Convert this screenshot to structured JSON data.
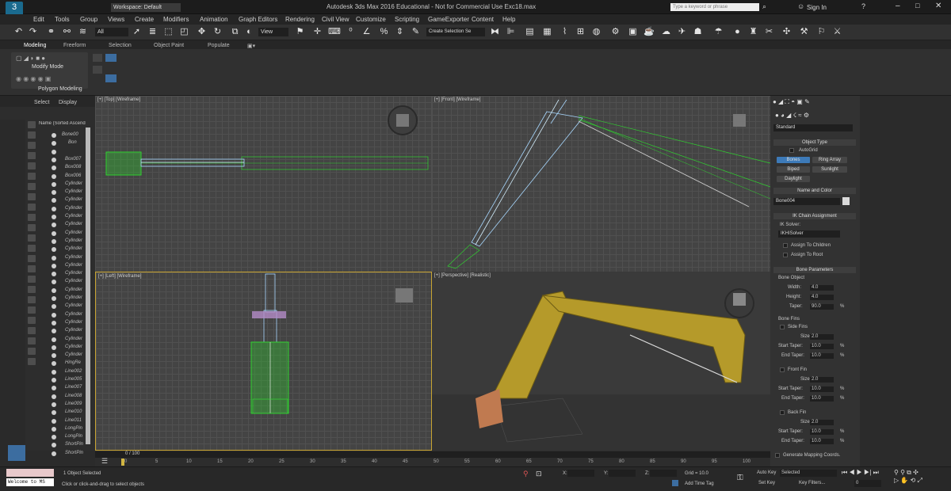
{
  "title": {
    "workspace": "Workspace: Default",
    "app_title": "Autodesk 3ds Max 2016 Educational - Not for Commercial Use   Exc18.max",
    "search_placeholder": "Type a keyword or phrase",
    "sign_in": "Sign In"
  },
  "menu": [
    "Edit",
    "Tools",
    "Group",
    "Views",
    "Create",
    "Modifiers",
    "Animation",
    "Graph Editors",
    "Rendering",
    "Civil View",
    "Customize",
    "Scripting",
    "GameExporter",
    "Content",
    "Help"
  ],
  "toolbar": {
    "selection_filter": "All",
    "ref_coord": "View",
    "named_set": "Create Selection Se"
  },
  "ribbon": {
    "tabs": [
      "Modeling",
      "Freeform",
      "Selection",
      "Object Paint",
      "Populate"
    ],
    "modify_mode": "Modify Mode",
    "polygon_modeling": "Polygon Modeling"
  },
  "scene": {
    "tabs": [
      "Select",
      "Display"
    ],
    "header": "Name (Sorted Ascend",
    "rows": [
      "Bone00",
      "Bon",
      "",
      "Box007",
      "Box008",
      "Box006",
      "Cylinder",
      "Cylinder",
      "Cylinder",
      "Cylinder",
      "Cylinder",
      "Cylinder",
      "Cylinder",
      "Cylinder",
      "Cylinder",
      "Cylinder",
      "Cylinder",
      "Cylinder",
      "Cylinder",
      "Cylinder",
      "Cylinder",
      "Cylinder",
      "Cylinder",
      "Cylinder",
      "Cylinder",
      "Cylinder",
      "Cylinder",
      "Cylinder",
      "HingRe",
      "Line002",
      "Line005",
      "Line007",
      "Line008",
      "Line009",
      "Line010",
      "Line011",
      "LongPin",
      "LongPin",
      "ShortPin",
      "ShortPin"
    ]
  },
  "viewports": {
    "top": "[+] [Top] [Wireframe]",
    "front": "[+] [Front] [Wireframe]",
    "left": "[+] [Left] [Wireframe]",
    "persp": "[+] [Perspective] [Realistic]"
  },
  "cmd": {
    "dropdown": "Standard",
    "object_type": "Object Type",
    "autogrid": "AutoGrid",
    "buttons": [
      "Bones",
      "Ring Array",
      "Biped",
      "Sunlight",
      "Daylight"
    ],
    "name_color": "Name and Color",
    "name_value": "Bone004",
    "ik_hdr": "IK Chain Assignment",
    "ik_solver_label": "IK Solver:",
    "ik_solver": "IKHISolver",
    "assign_children": "Assign To Children",
    "assign_root": "Assign To Root",
    "bone_params": "Bone Parameters",
    "bone_object": "Bone Object",
    "width_l": "Width:",
    "width_v": "4.0",
    "height_l": "Height:",
    "height_v": "4.0",
    "taper_l": "Taper:",
    "taper_v": "90.0",
    "bone_fins": "Bone Fins",
    "side_fins": "Side Fins",
    "front_fin": "Front Fin",
    "back_fin": "Back Fin",
    "size_l": "Size:",
    "size_v": "2.0",
    "start_taper_l": "Start Taper:",
    "start_taper_v": "10.0",
    "end_taper_l": "End Taper:",
    "end_taper_v": "10.0",
    "pct": "%",
    "gen_map": "Generate Mapping Coords."
  },
  "timeline": {
    "frame": "0 / 100",
    "ticks": [
      "0",
      "5",
      "10",
      "15",
      "20",
      "25",
      "30",
      "35",
      "40",
      "45",
      "50",
      "55",
      "60",
      "65",
      "70",
      "75",
      "80",
      "85",
      "90",
      "95",
      "100"
    ]
  },
  "status": {
    "welcome": "Welcome to MS",
    "selected": "1 Object Selected",
    "prompt": "Click or click-and-drag to select objects",
    "x": "X:",
    "y": "Y:",
    "z": "Z:",
    "grid": "Grid = 10.0",
    "add_time_tag": "Add Time Tag",
    "auto_key": "Auto Key",
    "auto_key_val": "Selected",
    "set_key": "Set Key",
    "key_filters": "Key Filters...",
    "frame_field": "0"
  }
}
